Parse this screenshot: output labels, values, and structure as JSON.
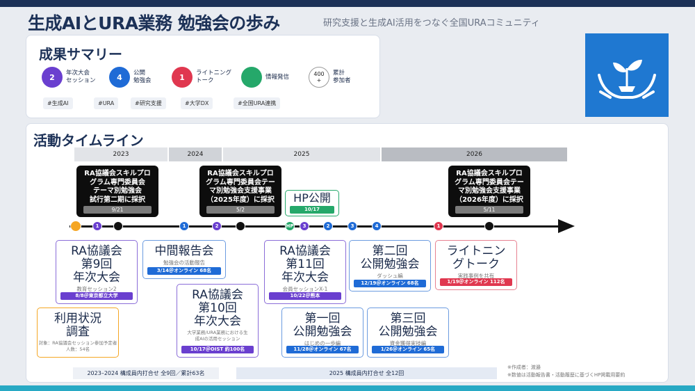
{
  "header": {
    "title": "生成AIとURA業務 勉強会の歩み",
    "subtitle": "研究支援と生成AI活用をつなぐ全国URAコミュニティ"
  },
  "summary": {
    "title": "成果サマリー",
    "stats": [
      {
        "value": "2",
        "label": "年次大会\nセッション",
        "color": "#6a3fcf"
      },
      {
        "value": "4",
        "label": "公開\n勉強会",
        "color": "#1f6bd6"
      },
      {
        "value": "1",
        "label": "ライトニング\nトーク",
        "color": "#e0374f"
      },
      {
        "value": "",
        "label": "情報発信",
        "color": "#25a86a"
      },
      {
        "value": "400\n+",
        "label": "累計\n参加者",
        "color": "#ffffff"
      }
    ],
    "tags": [
      "#生成AI",
      "#URA",
      "#研究支援",
      "#大学DX",
      "#全国URA連携"
    ]
  },
  "timeline": {
    "title": "活動タイムライン",
    "years": [
      "2023",
      "2024",
      "2025",
      "2026"
    ],
    "milestones": [
      {
        "text": "RA協議会スキルプロ\nグラム専門委員会\nテーマ別勉強会\n試行第二期に採択",
        "date": "9/21"
      },
      {
        "text": "RA協議会スキルプロ\nグラム専門委員会テー\nマ別勉強会支援事業\n（2025年度）に採択",
        "date": "5/2"
      },
      {
        "text": "RA協議会スキルプロ\nグラム専門委員会テー\nマ別勉強会支援事業\n（2026年度）に採択",
        "date": "5/11"
      }
    ],
    "hp": {
      "title": "HP公開",
      "date": "10/17",
      "dot": "HP"
    },
    "dots": [
      "1",
      "1",
      "2",
      "2",
      "3",
      "3",
      "4",
      "1"
    ],
    "events": [
      {
        "title": "RA協議会\n第9回\n年次大会",
        "sub": "教育セッション2",
        "pill": "8/8＠東京都立大学"
      },
      {
        "title": "利用状況\n調査",
        "sub": "対象：RA協議会セッション参加予定者\n人数：54名",
        "pill": ""
      },
      {
        "title": "中間報告会",
        "sub": "勉強会の活動報告",
        "pill": "3/14＠オンライン 68名"
      },
      {
        "title": "RA協議会\n第10回\n年次大会",
        "sub": "大学業務/URA業務における生\n成AIの活用セッション",
        "pill": "10/17＠OIST 約100名"
      },
      {
        "title": "RA協議会\n第11回\n年次大会",
        "sub": "会員セッションX-1",
        "pill": "10/22＠熊本"
      },
      {
        "title": "第一回\n公開勉強会",
        "sub": "はじめの一歩編",
        "pill": "11/28＠オンライン 67名"
      },
      {
        "title": "第二回\n公開勉強会",
        "sub": "ダッシュ編",
        "pill": "12/19＠オンライン 68名"
      },
      {
        "title": "第三回\n公開勉強会",
        "sub": "資金獲得実技編",
        "pill": "1/26＠オンライン 65名"
      },
      {
        "title": "ライトニン\nグトーク",
        "sub": "実践事例を共有",
        "pill": "1/19＠オンライン 112名"
      }
    ],
    "meetings": [
      "2023–2024 構成員内打合せ 全9回／累計63名",
      "2025 構成員内打合せ 全12回"
    ],
    "notes": [
      "※作成者：渡邉",
      "※数値は活動報告書・活動履歴に基づくHP掲載用要約"
    ]
  },
  "colors": {
    "navy": "#1c3157",
    "blue": "#1f78d1",
    "purple": "#6a3fcf",
    "red": "#e0374f",
    "green": "#25a86a",
    "orange": "#f5a623"
  }
}
